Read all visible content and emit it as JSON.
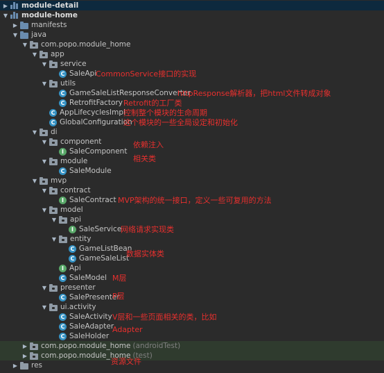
{
  "tree": [
    {
      "label": "module-detail",
      "indent": 0,
      "arrow": "collapsed",
      "icon": "module",
      "bold": true,
      "highlight": "sel"
    },
    {
      "label": "module-home",
      "indent": 0,
      "arrow": "expanded",
      "icon": "module",
      "bold": true
    },
    {
      "label": "manifests",
      "indent": 1,
      "arrow": "collapsed",
      "icon": "folder-blue"
    },
    {
      "label": "java",
      "indent": 1,
      "arrow": "expanded",
      "icon": "folder-blue"
    },
    {
      "label": "com.popo.module_home",
      "indent": 2,
      "arrow": "expanded",
      "icon": "package"
    },
    {
      "label": "app",
      "indent": 3,
      "arrow": "expanded",
      "icon": "package"
    },
    {
      "label": "service",
      "indent": 4,
      "arrow": "expanded",
      "icon": "package"
    },
    {
      "label": "SaleApi",
      "indent": 5,
      "arrow": "none",
      "icon": "class"
    },
    {
      "label": "utils",
      "indent": 4,
      "arrow": "expanded",
      "icon": "package"
    },
    {
      "label": "GameSaleListResponseConverter",
      "indent": 5,
      "arrow": "none",
      "icon": "class"
    },
    {
      "label": "RetrofitFactory",
      "indent": 5,
      "arrow": "none",
      "icon": "class"
    },
    {
      "label": "AppLifecyclesImpl",
      "indent": 4,
      "arrow": "none",
      "icon": "class"
    },
    {
      "label": "GlobalConfiguration",
      "indent": 4,
      "arrow": "none",
      "icon": "class"
    },
    {
      "label": "di",
      "indent": 3,
      "arrow": "expanded",
      "icon": "package"
    },
    {
      "label": "component",
      "indent": 4,
      "arrow": "expanded",
      "icon": "package"
    },
    {
      "label": "SaleComponent",
      "indent": 5,
      "arrow": "none",
      "icon": "interface"
    },
    {
      "label": "module",
      "indent": 4,
      "arrow": "expanded",
      "icon": "package"
    },
    {
      "label": "SaleModule",
      "indent": 5,
      "arrow": "none",
      "icon": "class"
    },
    {
      "label": "mvp",
      "indent": 3,
      "arrow": "expanded",
      "icon": "package"
    },
    {
      "label": "contract",
      "indent": 4,
      "arrow": "expanded",
      "icon": "package"
    },
    {
      "label": "SaleContract",
      "indent": 5,
      "arrow": "none",
      "icon": "interface"
    },
    {
      "label": "model",
      "indent": 4,
      "arrow": "expanded",
      "icon": "package"
    },
    {
      "label": "api",
      "indent": 5,
      "arrow": "expanded",
      "icon": "package"
    },
    {
      "label": "SaleService",
      "indent": 6,
      "arrow": "none",
      "icon": "interface"
    },
    {
      "label": "entity",
      "indent": 5,
      "arrow": "expanded",
      "icon": "package"
    },
    {
      "label": "GameListBean",
      "indent": 6,
      "arrow": "none",
      "icon": "class"
    },
    {
      "label": "GameSaleList",
      "indent": 6,
      "arrow": "none",
      "icon": "class"
    },
    {
      "label": "Api",
      "indent": 5,
      "arrow": "none",
      "icon": "interface"
    },
    {
      "label": "SaleModel",
      "indent": 5,
      "arrow": "none",
      "icon": "class"
    },
    {
      "label": "presenter",
      "indent": 4,
      "arrow": "expanded",
      "icon": "package"
    },
    {
      "label": "SalePresenter",
      "indent": 5,
      "arrow": "none",
      "icon": "class"
    },
    {
      "label": "ui.activity",
      "indent": 4,
      "arrow": "expanded",
      "icon": "package"
    },
    {
      "label": "SaleActivity",
      "indent": 5,
      "arrow": "none",
      "icon": "class"
    },
    {
      "label": "SaleAdapter",
      "indent": 5,
      "arrow": "none",
      "icon": "class"
    },
    {
      "label": "SaleHolder",
      "indent": 5,
      "arrow": "none",
      "icon": "class"
    },
    {
      "label": "com.popo.module_home",
      "suffix": "(androidTest)",
      "indent": 2,
      "arrow": "collapsed",
      "icon": "package",
      "highlight": "selg"
    },
    {
      "label": "com.popo.module_home",
      "suffix": "(test)",
      "indent": 2,
      "arrow": "collapsed",
      "icon": "package",
      "highlight": "selg"
    },
    {
      "label": "res",
      "indent": 1,
      "arrow": "collapsed",
      "icon": "folder-res"
    }
  ],
  "annotations": [
    {
      "row": 7,
      "text": "CommonService接口的实现",
      "col": "a"
    },
    {
      "row": 9,
      "text": "httpResponse解析器，把html文件转成对象",
      "col": "b"
    },
    {
      "row": 10,
      "text": "Retrofit的工厂类",
      "col": "c"
    },
    {
      "row": 11,
      "text": "控制整个模块的生命周期",
      "col": "c"
    },
    {
      "row": 12,
      "text": "这个模块的一些全局设定和初始化",
      "col": "c"
    },
    {
      "row": 14,
      "text": "依赖注入",
      "col": "d",
      "offset": 4
    },
    {
      "row": 16,
      "text": "相关类",
      "col": "d",
      "offset": -4
    },
    {
      "row": 20,
      "text": "MVP架构的统一接口，定义一些可复用的方法",
      "col": "e"
    },
    {
      "row": 23,
      "text": "网络请求实现类",
      "col": "f"
    },
    {
      "row": 26,
      "text": "数据实体类",
      "col": "g",
      "offset": -7
    },
    {
      "row": 28,
      "text": "M层",
      "col": "h"
    },
    {
      "row": 30,
      "text": "P层",
      "col": "h",
      "offset": -2
    },
    {
      "row": 32,
      "text": "V层和一些页面相关的类，比如",
      "col": "h"
    },
    {
      "row": 33,
      "text": "Adapter",
      "col": "h",
      "offset": 6
    },
    {
      "row": 36,
      "text": "资源文件",
      "col": "i",
      "offset": 8
    }
  ],
  "colors": {
    "background": "#2b2b2b",
    "annotation": "#e8302e",
    "selected": "#0d293e"
  }
}
